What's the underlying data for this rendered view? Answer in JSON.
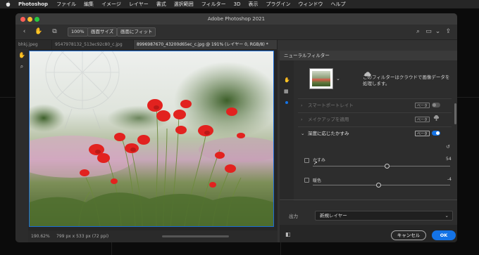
{
  "menubar": {
    "app": "Photoshop",
    "items": [
      "ファイル",
      "編集",
      "イメージ",
      "レイヤー",
      "書式",
      "選択範囲",
      "フィルター",
      "3D",
      "表示",
      "プラグイン",
      "ウィンドウ",
      "ヘルプ"
    ]
  },
  "window": {
    "title": "Adobe Photoshop 2021"
  },
  "options_bar": {
    "zoom_btn": "100%",
    "fit_screen_btn": "画面サイズ",
    "fill_screen_btn": "画面にフィット"
  },
  "tabs": [
    {
      "label": "bhkj.jpeg",
      "active": false
    },
    {
      "label": "9547978132_513ec92c80_c.jpg",
      "active": false
    },
    {
      "label": "8996987670_43200d65ec_c.jpg @ 191% (レイヤー 0, RGB/8) *",
      "active": true
    }
  ],
  "status": {
    "zoom": "190.62%",
    "doc_info": "799 px x 533 px (72 ppi)"
  },
  "panel": {
    "title": "ニューラルフィルター",
    "cloud_desc": "このフィルターはクラウドで画像データを処理します。",
    "filters": [
      {
        "label": "スマートポートレイト",
        "badge": "ベータ",
        "enabled": false,
        "dim": true
      },
      {
        "label": "メイクアップを適用",
        "badge": "ベータ",
        "enabled": false,
        "dim": true
      },
      {
        "label": "深度に応じたかすみ",
        "badge": "ベータ",
        "enabled": true,
        "dim": false
      }
    ],
    "sliders": [
      {
        "label": "かすみ",
        "value": "54",
        "fraction": 0.54
      },
      {
        "label": "暖色",
        "value": "-4",
        "fraction": 0.48
      }
    ],
    "output_label": "出力",
    "output_value": "新規レイヤー",
    "cancel": "キャンセル",
    "ok": "OK"
  },
  "colors": {
    "accent": "#1473e6",
    "toggle_on": "#1473e6"
  }
}
